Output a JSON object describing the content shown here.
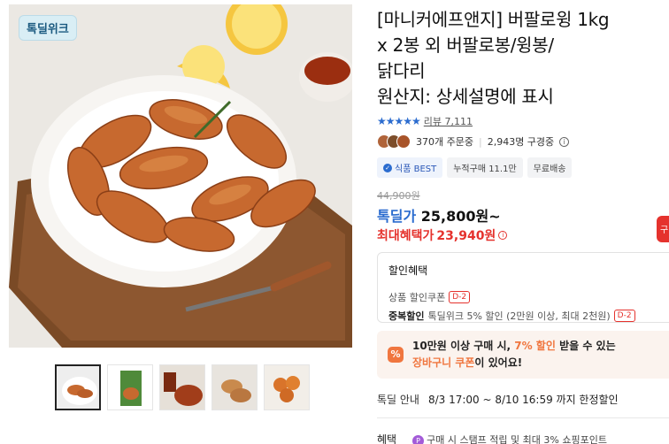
{
  "gallery": {
    "badge": "톡딜위크",
    "main_image": "chicken-wings-on-wooden-board-photo",
    "thumbnails": [
      {
        "name": "wings-plate-thumb",
        "active": true
      },
      {
        "name": "package-thumb",
        "active": false
      },
      {
        "name": "wings-with-sauce-thumb",
        "active": false
      },
      {
        "name": "drumsticks-thumb",
        "active": false
      },
      {
        "name": "wing-bites-thumb",
        "active": false
      }
    ]
  },
  "product": {
    "title_line1": "[마니커에프앤지] 버팔로윙 1kg",
    "title_line2": "x 2봉 외 버팔로봉/윙봉/",
    "title_line3": "닭다리",
    "title_line4": "원산지: 상세설명에 표시",
    "stars": "★★★★★",
    "review_label": "리뷰 7,111",
    "orders": "370개 주문중",
    "subscribers": "2,943명 구경중",
    "tags": [
      "식품 BEST",
      "누적구매 11.1만",
      "무료배송"
    ],
    "original_price": "44,900원",
    "deal_label": "톡딜가",
    "deal_price": "25,800원~",
    "max_label": "최대혜택가",
    "max_price": "23,940원"
  },
  "discount": {
    "title": "할인혜택",
    "row1_text": "상품 할인쿠폰",
    "row1_dday": "D-2",
    "row2_bold": "중복할인",
    "row2_text": "톡딜위크 5% 할인 (2만원 이상, 최대 2천원)",
    "row2_dday": "D-2"
  },
  "coupon": {
    "icon": "%",
    "line1_a": "10만원 이상 구매 시, ",
    "line1_b": "7% 할인",
    "line1_c": " 받을 수 있는",
    "line2_a": "장바구니 쿠폰",
    "line2_b": "이 있어요!"
  },
  "deal_info": {
    "label": "톡딜 안내",
    "value": "8/3 17:00 ~ 8/10 16:59 까지 한정할인"
  },
  "benefit": {
    "label": "혜택",
    "icon": "P",
    "text": "구매 시 스탬프 적립 및 최대 3% 쇼핑포인트"
  },
  "side_button": "구",
  "colors": {
    "accent_blue": "#2b6ccf",
    "accent_red": "#e5322d",
    "accent_orange": "#f0763f"
  }
}
